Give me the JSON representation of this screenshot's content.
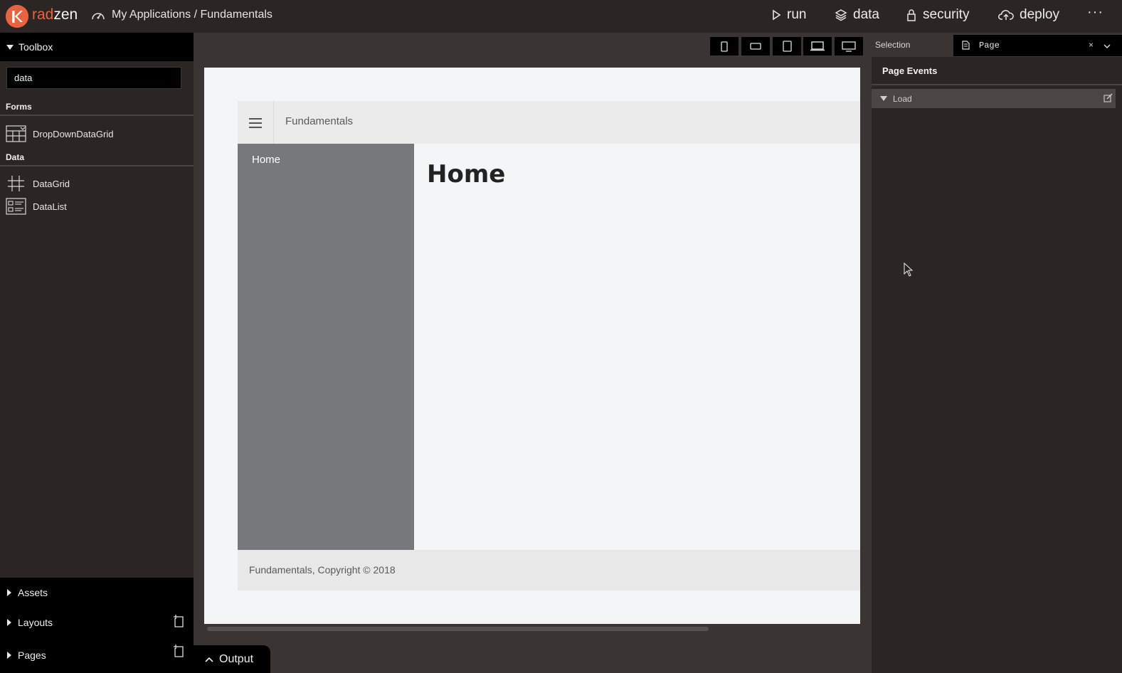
{
  "app": {
    "brand_left": "rad",
    "brand_right": "zen",
    "breadcrumb": "My Applications / Fundamentals",
    "nav": {
      "run": "run",
      "data": "data",
      "security": "security",
      "deploy": "deploy",
      "more": "···"
    },
    "accent_color": "#e8633f"
  },
  "toolbox": {
    "title": "Toolbox",
    "search_value": "data",
    "sections": [
      {
        "label": "Forms",
        "items": [
          {
            "label": "DropDownDataGrid",
            "icon": "dropdown-datagrid-icon"
          }
        ]
      },
      {
        "label": "Data",
        "items": [
          {
            "label": "DataGrid",
            "icon": "grid-icon"
          },
          {
            "label": "DataList",
            "icon": "datalist-icon"
          }
        ]
      }
    ],
    "panels": {
      "assets": "Assets",
      "layouts": "Layouts",
      "pages": "Pages"
    }
  },
  "devices": [
    "phone-portrait-icon",
    "phone-landscape-icon",
    "tablet-portrait-icon",
    "tablet-landscape-icon",
    "desktop-icon"
  ],
  "preview": {
    "header_title": "Fundamentals",
    "nav_item": "Home",
    "content_heading": "Home",
    "footer_text": "Fundamentals, Copyright © 2018"
  },
  "output": {
    "label": "Output"
  },
  "properties": {
    "selection_label": "Selection",
    "selected_value": "Page",
    "clear": "×",
    "page_events_title": "Page Events",
    "events": [
      {
        "label": "Load"
      }
    ]
  }
}
